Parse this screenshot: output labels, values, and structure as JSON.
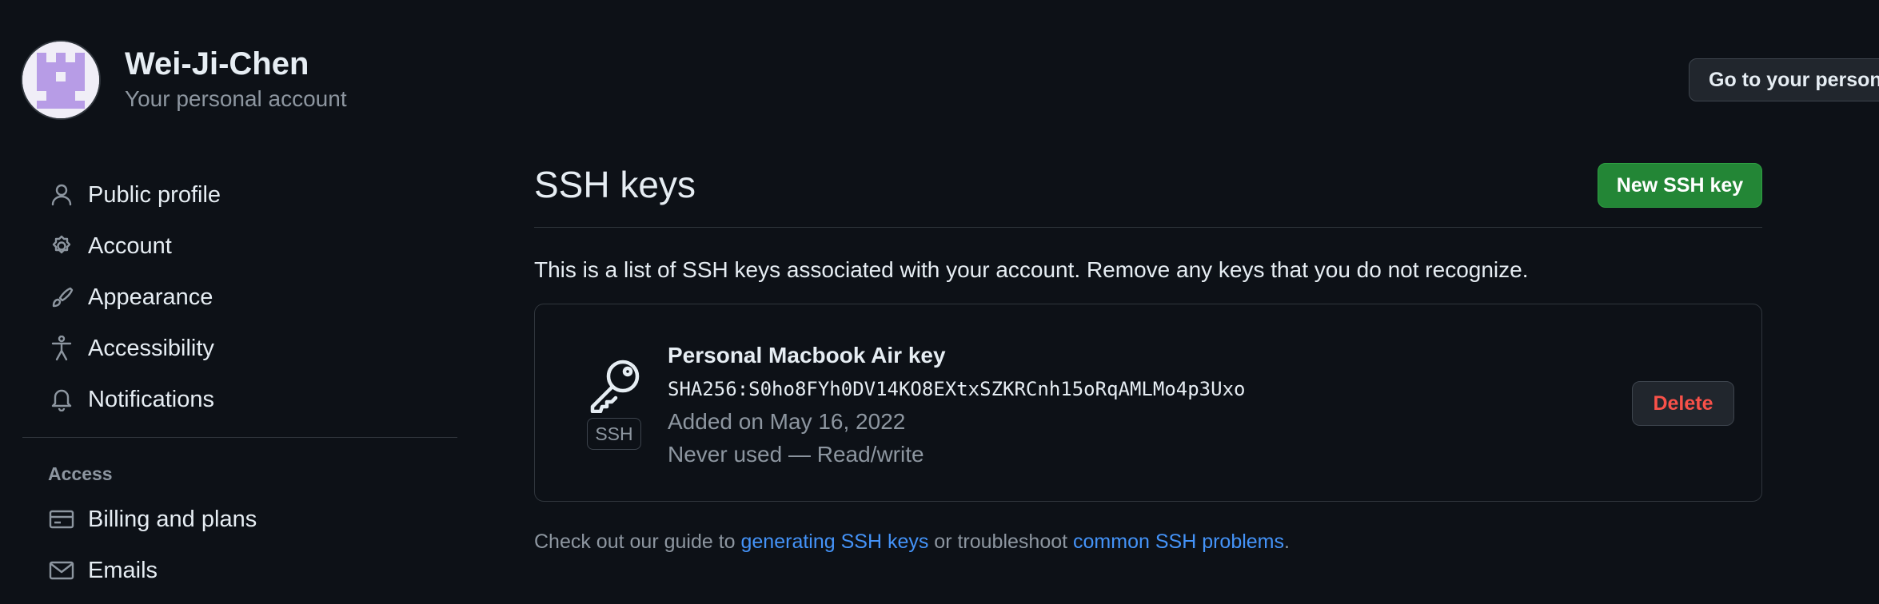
{
  "account": {
    "name": "Wei-Ji-Chen",
    "subtitle": "Your personal account",
    "goto_button": "Go to your personal profile"
  },
  "sidebar": {
    "items": [
      {
        "label": "Public profile",
        "icon": "person-icon"
      },
      {
        "label": "Account",
        "icon": "gear-icon"
      },
      {
        "label": "Appearance",
        "icon": "paintbrush-icon"
      },
      {
        "label": "Accessibility",
        "icon": "accessibility-icon"
      },
      {
        "label": "Notifications",
        "icon": "bell-icon"
      }
    ],
    "access_heading": "Access",
    "access_items": [
      {
        "label": "Billing and plans",
        "icon": "credit-card-icon"
      },
      {
        "label": "Emails",
        "icon": "mail-icon"
      }
    ]
  },
  "main": {
    "title": "SSH keys",
    "new_button": "New SSH key",
    "description": "This is a list of SSH keys associated with your account. Remove any keys that you do not recognize.",
    "keys": [
      {
        "title": "Personal Macbook Air key",
        "fingerprint": "SHA256:S0ho8FYh0DV14KO8EXtxSZKRCnh15oRqAMLMo4p3Uxo",
        "added": "Added on May 16, 2022",
        "usage": "Never used — Read/write",
        "badge": "SSH",
        "icon": "key-icon",
        "delete_label": "Delete"
      }
    ],
    "footer": {
      "prefix": "Check out our guide to ",
      "link1": "generating SSH keys",
      "middle": " or troubleshoot ",
      "link2": "common SSH problems",
      "suffix": "."
    }
  },
  "colors": {
    "background": "#0d1117",
    "primary_button": "#238636",
    "danger": "#f85149",
    "link": "#4493f8",
    "muted": "#8d96a0",
    "avatar_purple": "#b79ce6"
  }
}
